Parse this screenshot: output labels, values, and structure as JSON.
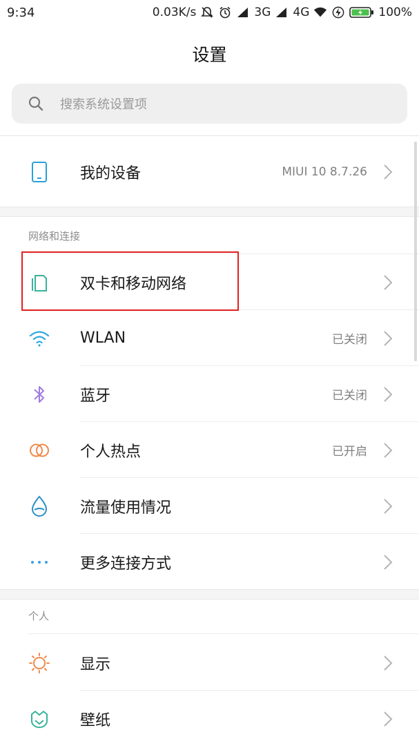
{
  "status_bar": {
    "time": "9:34",
    "net_speed": "0.03K/s",
    "sim1_type": "3G",
    "sim2_type": "4G",
    "battery": "100%"
  },
  "header": {
    "title": "设置"
  },
  "search": {
    "placeholder": "搜索系统设置项"
  },
  "device": {
    "label": "我的设备",
    "value": "MIUI 10 8.7.26",
    "icon": "phone-icon"
  },
  "sections": {
    "network": {
      "title": "网络和连接",
      "items": [
        {
          "label": "双卡和移动网络",
          "value": "",
          "icon": "sim-cards-icon",
          "icon_color": "#39b29a"
        },
        {
          "label": "WLAN",
          "value": "已关闭",
          "icon": "wifi-icon",
          "icon_color": "#2ea7e0"
        },
        {
          "label": "蓝牙",
          "value": "已关闭",
          "icon": "bluetooth-icon",
          "icon_color": "#a07be0"
        },
        {
          "label": "个人热点",
          "value": "已开启",
          "icon": "hotspot-icon",
          "icon_color": "#f08a4b"
        },
        {
          "label": "流量使用情况",
          "value": "",
          "icon": "data-usage-icon",
          "icon_color": "#2a8fc7"
        },
        {
          "label": "更多连接方式",
          "value": "",
          "icon": "more-dots-icon",
          "icon_color": "#3a9fe0"
        }
      ]
    },
    "personal": {
      "title": "个人",
      "items": [
        {
          "label": "显示",
          "value": "",
          "icon": "display-icon",
          "icon_color": "#f08a4b"
        },
        {
          "label": "壁纸",
          "value": "",
          "icon": "wallpaper-icon",
          "icon_color": "#39b29a"
        }
      ]
    }
  },
  "colors": {
    "highlight_box": "#e02020",
    "background": "#ffffff",
    "gap": "#f5f5f5"
  }
}
